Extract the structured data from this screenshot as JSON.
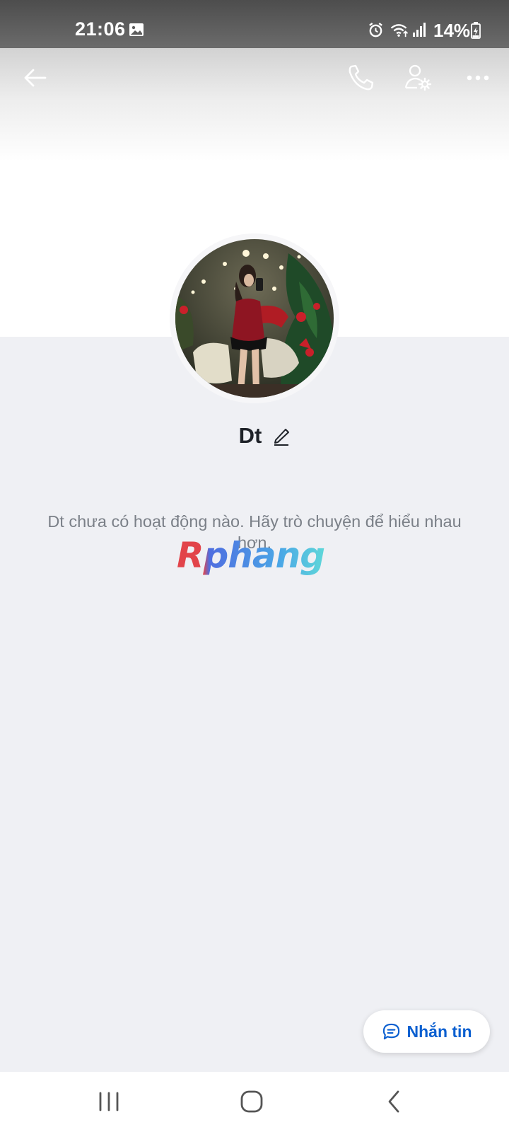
{
  "status_bar": {
    "time": "21:06",
    "battery": "14%",
    "icons": [
      "gallery-icon",
      "alarm-icon",
      "wifi-icon",
      "signal-icon",
      "battery-charging-icon"
    ]
  },
  "header": {
    "icons": [
      "back-arrow-icon",
      "phone-icon",
      "user-settings-icon",
      "more-icon"
    ]
  },
  "profile": {
    "name": "Dt",
    "empty_activity_text": "Dt chưa có hoạt động nào. Hãy trò chuyện để hiểu nhau hơn."
  },
  "watermark": {
    "text": "Rphang"
  },
  "actions": {
    "message_label": "Nhắn tin"
  },
  "system_nav": {
    "icons": [
      "recents-icon",
      "home-icon",
      "back-icon"
    ]
  },
  "colors": {
    "accent": "#0a5fd0",
    "background": "#eff0f4",
    "muted_text": "#7b8088"
  }
}
